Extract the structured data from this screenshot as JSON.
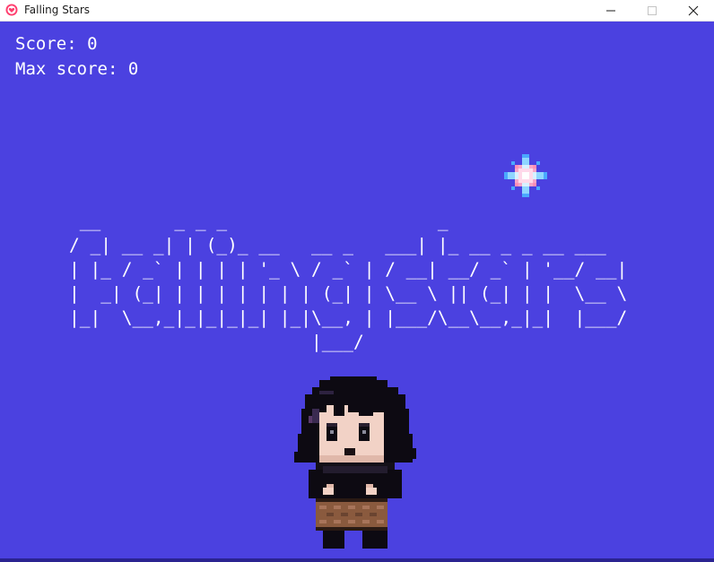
{
  "window": {
    "title": "Falling Stars",
    "icon": "heart-app-icon",
    "controls": [
      "minimize-icon",
      "maximize-icon",
      "close-icon"
    ]
  },
  "hud": {
    "score_text": "Score: 0",
    "max_score_text": "Max score: 0"
  },
  "ascii_title": " __       _ _ _                    _\n/ _| __ _| | (_)_ __   __ _   ___| |_ __ _ _ __ ___\n| |_ / _` | | | | '_ \\ / _` | / __| __/ _` | '__/ __|\n|  _| (_| | | | | | | | (_| | \\__ \\ || (_| | |  \\__ \\\n|_|  \\__,_|_|_|_|_| |_|\\__, | |___/\\__\\__,_|_|  |___/\n                       |___/",
  "colors": {
    "background": "#4b41e0",
    "text": "#ffffff"
  },
  "sprites": {
    "star": "falling-star-icon",
    "player": "girl-with-basket-sprite"
  }
}
